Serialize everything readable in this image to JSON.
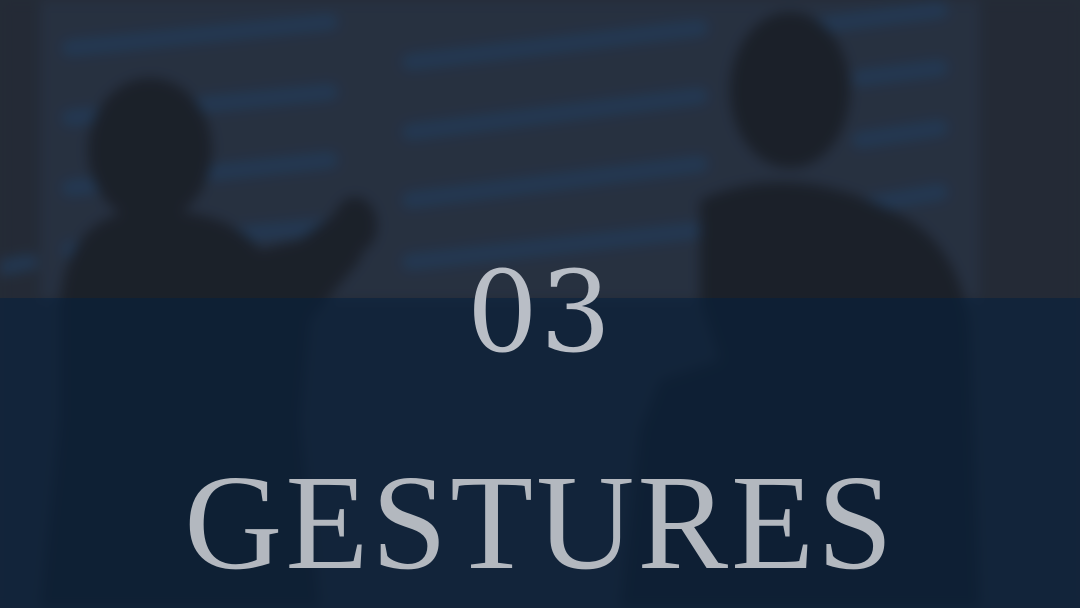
{
  "slide": {
    "number": "03",
    "title": "GESTURES"
  },
  "background": {
    "image": "blurred-silhouettes-of-two-people-in-front-of-window-blinds",
    "overlay_top_color": "#2a303a",
    "overlay_bottom_color": "#10243c",
    "text_color": "#b3b8bf"
  }
}
